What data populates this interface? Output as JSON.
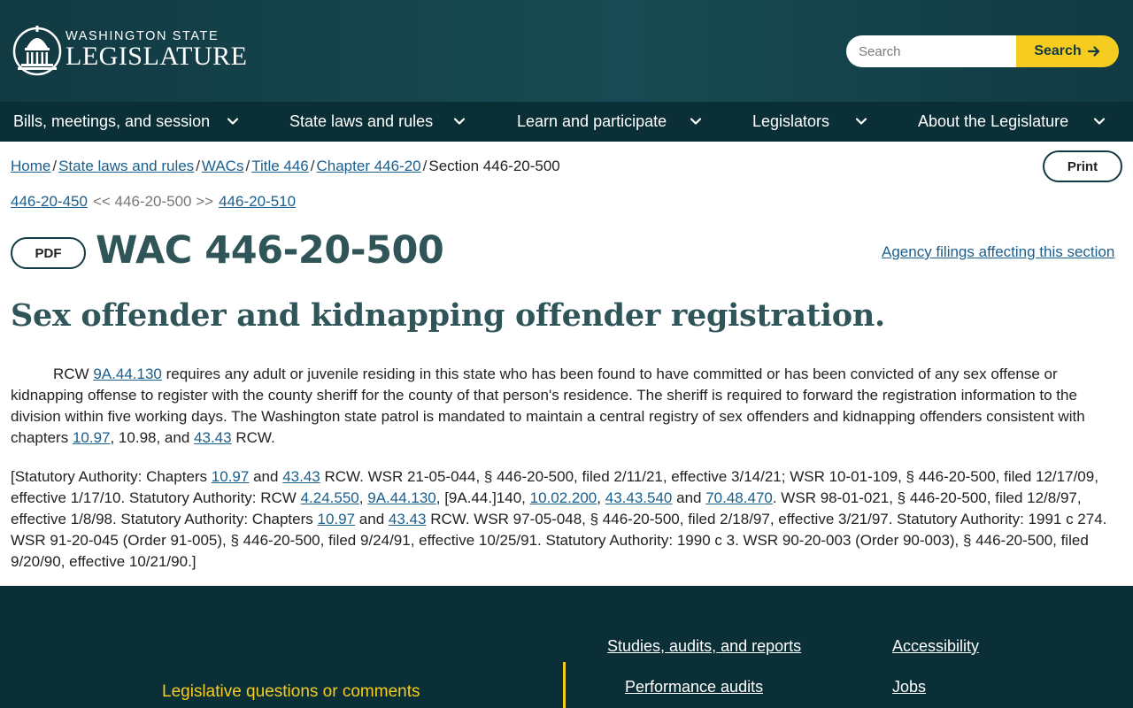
{
  "header": {
    "logo_line1": "WASHINGTON STATE",
    "logo_line2": "LEGISLATURE",
    "search_placeholder": "Search",
    "search_button": "Search"
  },
  "nav": {
    "items": [
      {
        "label": "Bills, meetings, and session"
      },
      {
        "label": "State laws and rules"
      },
      {
        "label": "Learn and participate"
      },
      {
        "label": "Legislators"
      },
      {
        "label": "About the Legislature"
      }
    ]
  },
  "breadcrumb": {
    "items": [
      "Home",
      "State laws and rules",
      "WACs",
      "Title 446",
      "Chapter 446-20"
    ],
    "current": "Section 446-20-500",
    "separator": "/"
  },
  "print_button": "Print",
  "sequence": {
    "prev": "446-20-450",
    "current": "<< 446-20-500 >>",
    "next": "446-20-510"
  },
  "pdf_button": "PDF",
  "title": "WAC 446-20-500",
  "agency_link": "Agency filings affecting this section",
  "caption": "Sex offender and kidnapping offender registration.",
  "body": {
    "p1_prefix": "RCW",
    "p1_link1": "9A.44.130",
    "p1_text1": "requires any adult or juvenile residing in this state who has been found to have committed or has been convicted of any sex offense or kidnapping offense to register with the county sheriff for the county of that person's residence. The sheriff is required to forward the registration information to the division within five working days. The Washington state patrol is mandated to maintain a central registry of sex offenders and kidnapping offenders consistent with chapters",
    "p1_link2": "10.97",
    "p1_text2": ", 10.98, and",
    "p1_link3": "43.43",
    "p1_text3": "RCW."
  },
  "history": {
    "t1": "[Statutory Authority: Chapters",
    "l1": "10.97",
    "t2": "and",
    "l2": "43.43",
    "t3": "RCW. WSR 21-05-044, § 446-20-500, filed 2/11/21, effective 3/14/21; WSR 10-01-109, § 446-20-500, filed 12/17/09, effective 1/17/10. Statutory Authority: RCW",
    "l3": "4.24.550",
    "t4": ",",
    "l4": "9A.44.130",
    "t5": ", [9A.44.]140,",
    "l5": "10.02.200",
    "t6": ",",
    "l6": "43.43.540",
    "t7": "and",
    "l7": "70.48.470",
    "t8": ". WSR 98-01-021, § 446-20-500, filed 12/8/97, effective 1/8/98. Statutory Authority: Chapters",
    "l8": "10.97",
    "t9": "and",
    "l9": "43.43",
    "t10": "RCW. WSR 97-05-048, § 446-20-500, filed 2/18/97, effective 3/21/97. Statutory Authority: 1991 c 274. WSR 91-20-045 (Order 91-005), § 446-20-500, filed 9/24/91, effective 10/25/91. Statutory Authority: 1990 c 3. WSR 90-20-003 (Order 90-003), § 446-20-500, filed 9/20/90, effective 10/21/90.]"
  },
  "footer": {
    "questions": "Legislative questions or comments",
    "links": [
      "Studies, audits, and reports",
      "Performance audits",
      "Accessibility",
      "Jobs"
    ]
  },
  "colors": {
    "header_bg": "#174a52",
    "nav_bg": "#0b2f36",
    "accent_yellow": "#f5cc1f",
    "link_blue": "#1a5f8e",
    "title_teal": "#2f5558"
  },
  "icons": [
    "capitol-dome-icon",
    "arrow-right-icon",
    "chevron-down-icon"
  ]
}
